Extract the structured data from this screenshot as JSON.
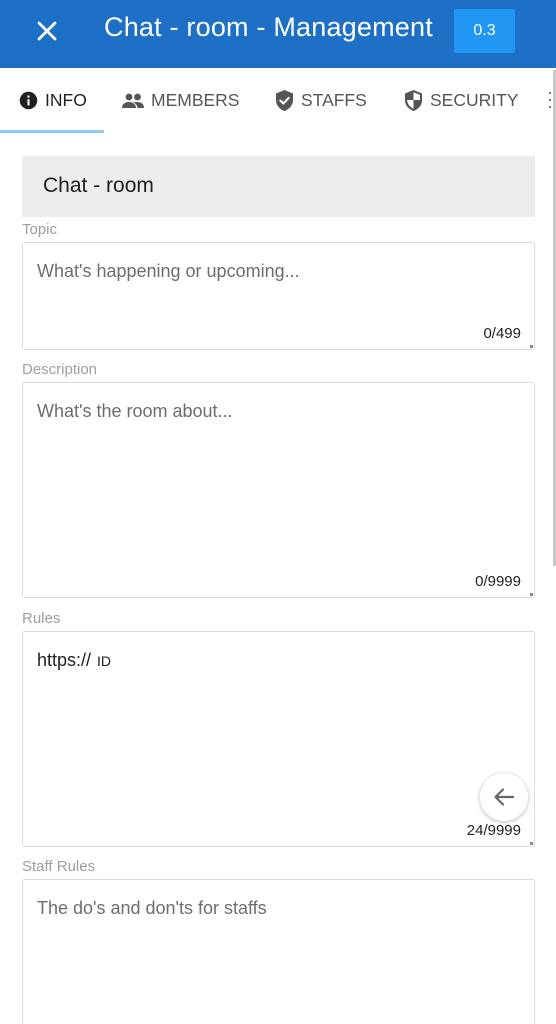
{
  "appbar": {
    "title": "Chat - room - Management",
    "version": "0.3",
    "close_icon": "close-icon",
    "background": "#1e6fc6",
    "badge_color": "#2196f3"
  },
  "tabs": [
    {
      "label": "INFO",
      "icon": "info-icon",
      "active": true
    },
    {
      "label": "MEMBERS",
      "icon": "people-icon",
      "active": false
    },
    {
      "label": "STAFFS",
      "icon": "shield-check-icon",
      "active": false
    },
    {
      "label": "SECURITY",
      "icon": "security-shield-icon",
      "active": false
    }
  ],
  "room": {
    "name": "Chat - room"
  },
  "fields": {
    "topic": {
      "label": "Topic",
      "placeholder": "What's happening or upcoming...",
      "counter": "0/499"
    },
    "description": {
      "label": "Description",
      "placeholder": "What's the room about...",
      "counter": "0/9999"
    },
    "rules": {
      "label": "Rules",
      "value": "https://",
      "suffix": "ID",
      "counter": "24/9999"
    },
    "staff_rules": {
      "label": "Staff Rules",
      "placeholder": "The do's and don'ts for staffs"
    }
  },
  "fab": {
    "icon": "arrow-back-icon"
  }
}
